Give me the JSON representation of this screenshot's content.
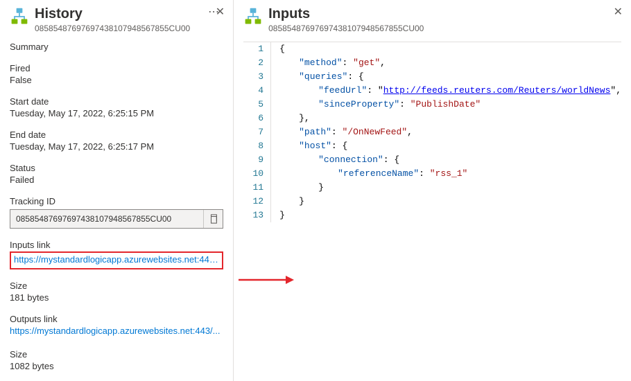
{
  "history": {
    "title": "History",
    "id": "08585487697697438107948567855CU00",
    "summary": {
      "label": "Summary"
    },
    "fired": {
      "label": "Fired",
      "value": "False"
    },
    "startDate": {
      "label": "Start date",
      "value": "Tuesday, May 17, 2022, 6:25:15 PM"
    },
    "endDate": {
      "label": "End date",
      "value": "Tuesday, May 17, 2022, 6:25:17 PM"
    },
    "status": {
      "label": "Status",
      "value": "Failed"
    },
    "trackingId": {
      "label": "Tracking ID",
      "value": "08585487697697438107948567855CU00"
    },
    "inputsLink": {
      "label": "Inputs link",
      "url": "https://mystandardlogicapp.azurewebsites.net:443/..."
    },
    "inputsSize": {
      "label": "Size",
      "value": "181 bytes"
    },
    "outputsLink": {
      "label": "Outputs link",
      "url": "https://mystandardlogicapp.azurewebsites.net:443/..."
    },
    "outputsSize": {
      "label": "Size",
      "value": "1082 bytes"
    }
  },
  "inputs": {
    "title": "Inputs",
    "id": "08585487697697438107948567855CU00",
    "json": {
      "method": "get",
      "queries": {
        "feedUrl": "http://feeds.reuters.com/Reuters/worldNews",
        "sinceProperty": "PublishDate"
      },
      "path": "/OnNewFeed",
      "host": {
        "connection": {
          "referenceName": "rss_1"
        }
      }
    }
  }
}
